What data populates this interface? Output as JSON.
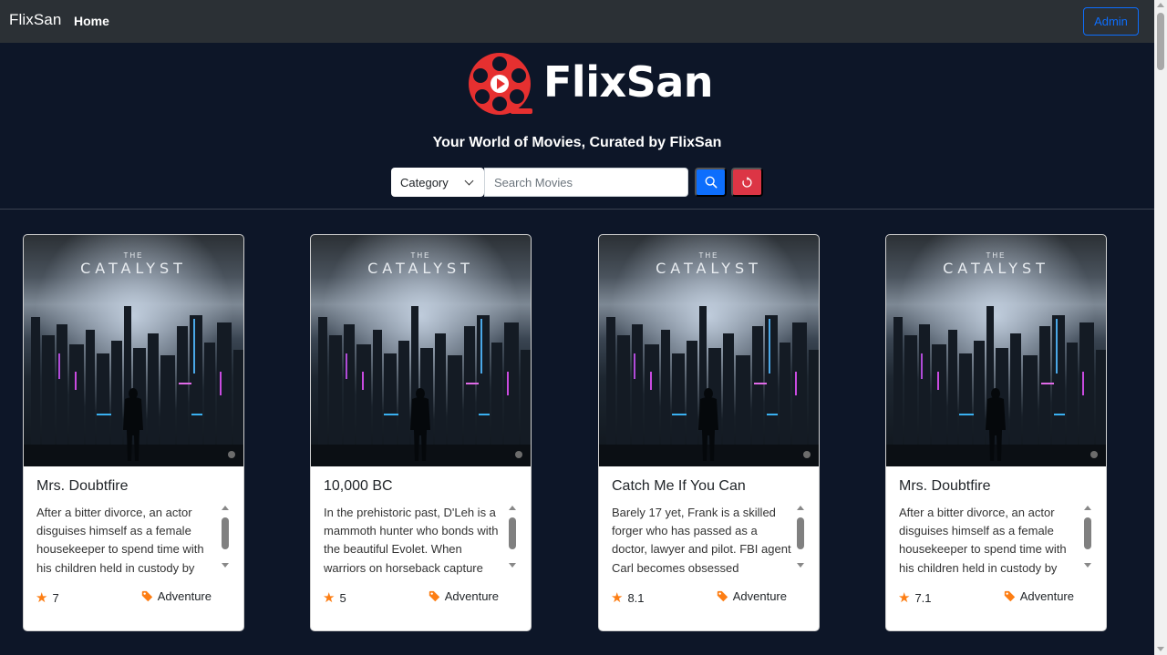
{
  "navbar": {
    "brand": "FlixSan",
    "home_label": "Home",
    "admin_label": "Admin"
  },
  "hero": {
    "logo_text": "FlixSan",
    "tagline": "Your World of Movies, Curated by FlixSan"
  },
  "search": {
    "category_label": "Category",
    "placeholder": "Search Movies"
  },
  "poster": {
    "title_small": "THE",
    "title": "CATALYST"
  },
  "movies": [
    {
      "title": "Mrs. Doubtfire",
      "description": "After a bitter divorce, an actor disguises himself as a female housekeeper to spend time with his children held in custody by",
      "rating": "7",
      "genre": "Adventure"
    },
    {
      "title": "10,000 BC",
      "description": "In the prehistoric past, D'Leh is a mammoth hunter who bonds with the beautiful Evolet. When warriors on horseback capture",
      "rating": "5",
      "genre": "Adventure"
    },
    {
      "title": "Catch Me If You Can",
      "description": "Barely 17 yet, Frank is a skilled forger who has passed as a doctor, lawyer and pilot. FBI agent Carl becomes obsessed",
      "rating": "8.1",
      "genre": "Adventure"
    },
    {
      "title": "Mrs. Doubtfire",
      "description": "After a bitter divorce, an actor disguises himself as a female housekeeper to spend time with his children held in custody by",
      "rating": "7.1",
      "genre": "Adventure"
    }
  ],
  "colors": {
    "background": "#0d1628",
    "navbar": "#2b3035",
    "primary": "#0d6efd",
    "danger": "#dc3545",
    "star": "#fd7e14",
    "logo_red": "#e63030"
  },
  "icons": {
    "search": "search-icon",
    "reset": "refresh-icon",
    "rating": "star-icon",
    "genre": "tag-icon",
    "logo": "film-reel-icon"
  }
}
